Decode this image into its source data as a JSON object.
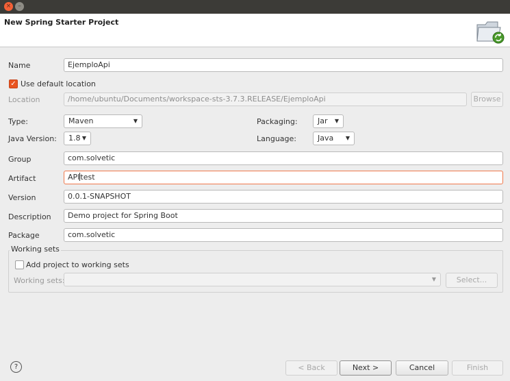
{
  "window": {
    "close_glyph": "×",
    "minimize_glyph": "–"
  },
  "banner": {
    "title": "New Spring Starter Project",
    "icon": "folder-refresh-icon"
  },
  "form": {
    "name_label": "Name",
    "name_value": "EjemploApi",
    "use_default_location_label": "Use default location",
    "use_default_location_checked": true,
    "location_label": "Location",
    "location_value": "/home/ubuntu/Documents/workspace-sts-3.7.3.RELEASE/EjemploApi",
    "browse_label": "Browse",
    "type_label": "Type:",
    "type_value": "Maven",
    "packaging_label": "Packaging:",
    "packaging_value": "Jar",
    "java_version_label": "Java Version:",
    "java_version_value": "1.8",
    "language_label": "Language:",
    "language_value": "Java",
    "group_label": "Group",
    "group_value": "com.solvetic",
    "artifact_label": "Artifact",
    "artifact_value_before": "API",
    "artifact_value_after": "test",
    "version_label": "Version",
    "version_value": "0.0.1-SNAPSHOT",
    "description_label": "Description",
    "description_value": "Demo project for Spring Boot",
    "package_label": "Package",
    "package_value": "com.solvetic"
  },
  "working_sets": {
    "title": "Working sets",
    "add_label": "Add project to working sets",
    "add_checked": false,
    "sets_label": "Working sets:",
    "sets_value": "",
    "select_label": "Select..."
  },
  "footer": {
    "help_glyph": "?",
    "back_label": "< Back",
    "next_label": "Next >",
    "cancel_label": "Cancel",
    "finish_label": "Finish"
  },
  "colors": {
    "accent": "#e95420",
    "focus_border": "#f0784b"
  }
}
